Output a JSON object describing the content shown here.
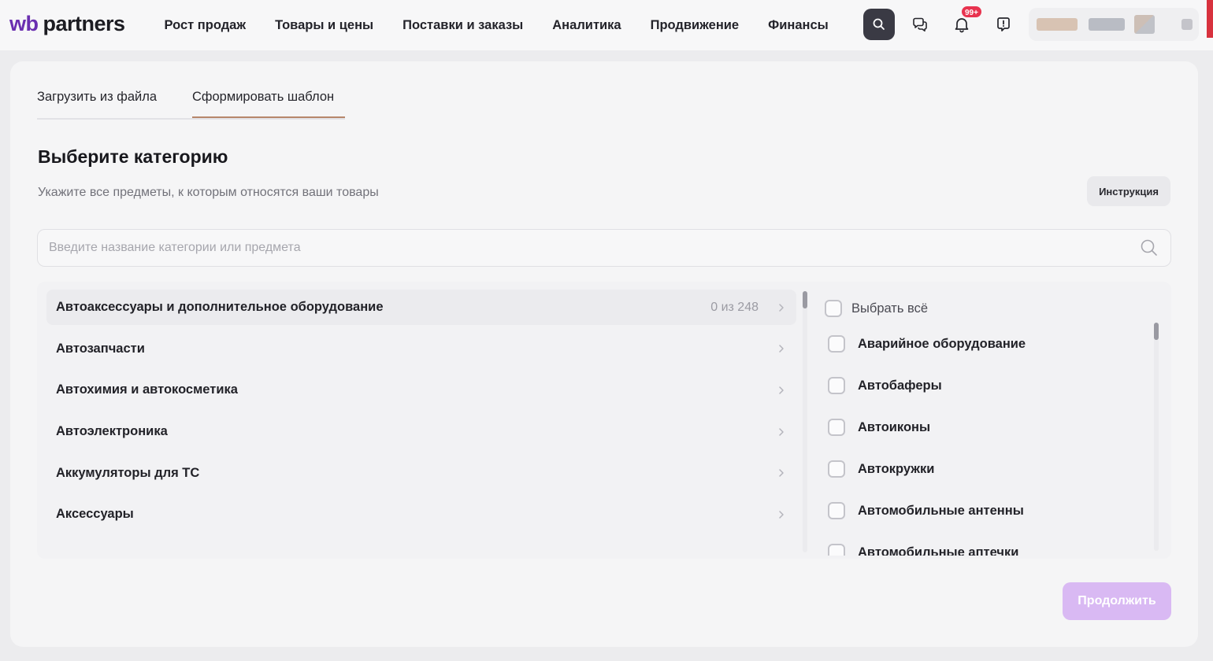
{
  "brand": {
    "part1": "wb",
    "part2": "partners",
    "color": "#6a2fb0"
  },
  "nav": {
    "items": [
      {
        "label": "Рост продаж"
      },
      {
        "label": "Товары и цены"
      },
      {
        "label": "Поставки и заказы"
      },
      {
        "label": "Аналитика"
      },
      {
        "label": "Продвижение"
      },
      {
        "label": "Финансы"
      }
    ],
    "icons": [
      "search-icon",
      "chat-icon",
      "bell-icon",
      "feedback-icon"
    ],
    "notifications_badge": "99+",
    "badge_color": "#e8334f"
  },
  "tabs": [
    {
      "label": "Загрузить из файла",
      "active": false
    },
    {
      "label": "Сформировать шаблон",
      "active": true
    }
  ],
  "page": {
    "title": "Выберите категорию",
    "subtitle": "Укажите все предметы, к которым относятся ваши товары",
    "instructions_button": "Инструкция"
  },
  "search": {
    "placeholder": "Введите название категории или предмета",
    "value": ""
  },
  "categories": [
    {
      "name": "Автоаксессуары и дополнительное оборудование",
      "count": "0 из 248",
      "active": true
    },
    {
      "name": "Автозапчасти",
      "count": "",
      "active": false
    },
    {
      "name": "Автохимия и автокосметика",
      "count": "",
      "active": false
    },
    {
      "name": "Автоэлектроника",
      "count": "",
      "active": false
    },
    {
      "name": "Аккумуляторы для ТС",
      "count": "",
      "active": false
    },
    {
      "name": "Аксессуары",
      "count": "",
      "active": false
    }
  ],
  "subjects": {
    "select_all_label": "Выбрать всё",
    "items": [
      {
        "label": "Аварийное оборудование",
        "checked": false
      },
      {
        "label": "Автобаферы",
        "checked": false
      },
      {
        "label": "Автоиконы",
        "checked": false
      },
      {
        "label": "Автокружки",
        "checked": false
      },
      {
        "label": "Автомобильные антенны",
        "checked": false
      },
      {
        "label": "Автомобильные аптечки",
        "checked": false
      }
    ]
  },
  "continue_button": {
    "label": "Продолжить",
    "enabled": false,
    "color": "#d9b9f3"
  }
}
